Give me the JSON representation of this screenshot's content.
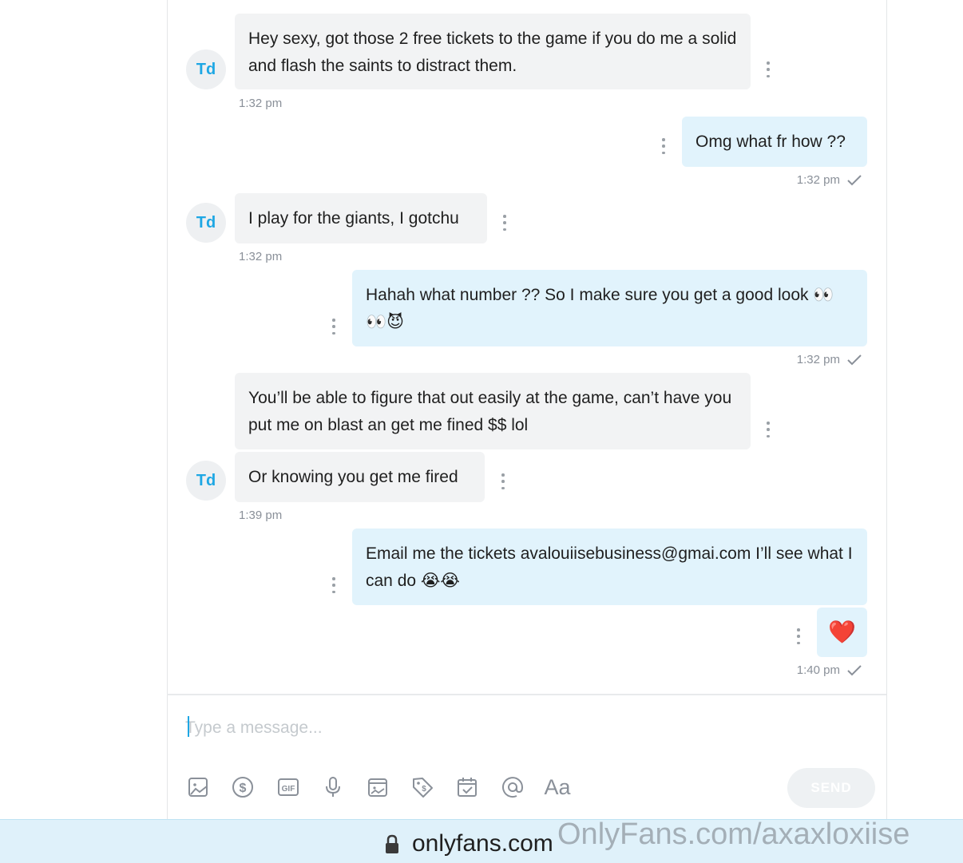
{
  "contact": {
    "avatar_initials": "Td"
  },
  "messages": [
    {
      "dir": "in",
      "text": "Hey sexy, got those 2 free tickets to the game if you do me a solid and flash the saints to distract them.",
      "time": "1:32 pm"
    },
    {
      "dir": "out",
      "text": "Omg what fr how ??",
      "time": "1:32 pm",
      "read": true
    },
    {
      "dir": "in",
      "text": "I play for the giants, I gotchu",
      "time": "1:32 pm"
    },
    {
      "dir": "out",
      "text": "Hahah what number ?? So I make sure you get a good look 👀👀😈",
      "time": "1:32 pm",
      "read": true
    },
    {
      "dir": "in",
      "text": "You’ll be able to figure that out easily at the game, can’t have you put me on blast an get me fined $$ lol"
    },
    {
      "dir": "in",
      "text": "Or knowing you get me fired",
      "time": "1:39 pm"
    },
    {
      "dir": "out",
      "text": "Email me the tickets avalouiisebusiness@gmai.com I’ll see what I can do 😭😭"
    },
    {
      "dir": "out",
      "text": "❤️",
      "time": "1:40 pm",
      "read": true
    }
  ],
  "composer": {
    "placeholder": "Type a message...",
    "text_tool": "Aa",
    "send_label": "SEND"
  },
  "browser": {
    "url": "onlyfans.com",
    "watermark": "OnlyFans.com/axaxloxiise"
  },
  "colors": {
    "accent": "#1ea7e4",
    "incoming_bubble": "#f2f3f4",
    "outgoing_bubble": "#e1f3fc",
    "address_bar": "#dff1fa"
  }
}
